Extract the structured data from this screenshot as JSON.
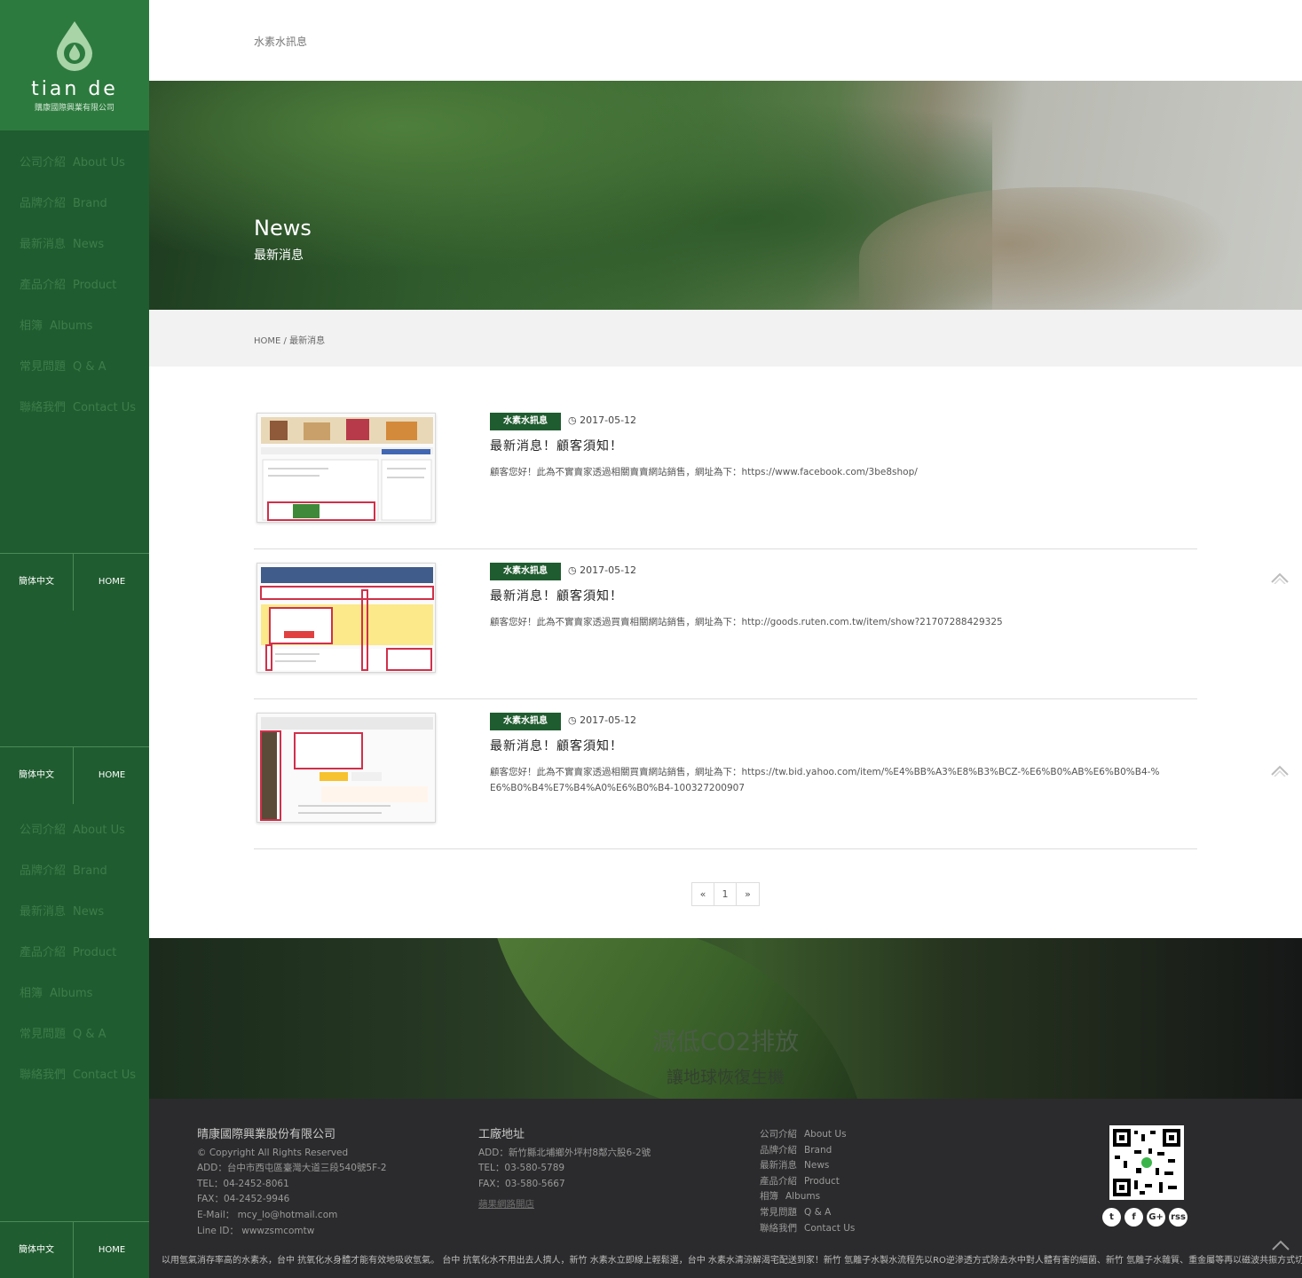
{
  "brand": {
    "name": "tian de",
    "subtitle": "購康國際興業有限公司"
  },
  "sidebar": {
    "items": [
      {
        "zh": "公司介紹",
        "en": "About Us"
      },
      {
        "zh": "品牌介紹",
        "en": "Brand"
      },
      {
        "zh": "最新消息",
        "en": "News"
      },
      {
        "zh": "產品介紹",
        "en": "Product"
      },
      {
        "zh": "相簿",
        "en": "Albums"
      },
      {
        "zh": "常見問題",
        "en": "Q & A"
      },
      {
        "zh": "聯絡我們",
        "en": "Contact Us"
      }
    ],
    "lang": "簡体中文",
    "home": "HOME"
  },
  "topbar": {
    "category": "水素水訊息"
  },
  "hero": {
    "title": "News",
    "subtitle": "最新消息"
  },
  "breadcrumb": {
    "home": "HOME",
    "sep": " / ",
    "current": "最新消息"
  },
  "articles": [
    {
      "tag": "水素水訊息",
      "date": "2017-05-12",
      "title": "最新消息！顧客須知！",
      "body": "顧客您好！此為不實賣家透過相關賣賣網站銷售，網址為下：https://www.facebook.com/3be8shop/"
    },
    {
      "tag": "水素水訊息",
      "date": "2017-05-12",
      "title": "最新消息！顧客須知！",
      "body": "顧客您好！此為不實賣家透過買賣相關網站銷售，網址為下：http://goods.ruten.com.tw/item/show?21707288429325"
    },
    {
      "tag": "水素水訊息",
      "date": "2017-05-12",
      "title": "最新消息！顧客須知！",
      "body": "顧客您好！此為不實賣家透過相關買賣網站銷售，網址為下：https://tw.bid.yahoo.com/item/%E4%BB%A3%E8%B3%BCZ-%E6%B0%AB%E6%B0%B4-%E6%B0%B4%E7%B4%A0%E6%B0%B4-100327200907"
    }
  ],
  "pager": {
    "prev": "«",
    "page": "1",
    "next": "»"
  },
  "band": {
    "line1": "減低CO2排放",
    "line2": "讓地球恢復生機"
  },
  "footer": {
    "company": {
      "name": "晴康國際興業股份有限公司",
      "copyright": "© Copyright All Rights Reserved",
      "add": "ADD：台中市西屯區臺灣大道三段540號5F-2",
      "tel": "TEL：04-2452-8061",
      "fax": "FAX：04-2452-9946",
      "email": "E-Mail： mcy_lo@hotmail.com",
      "line": "Line ID： wwwzsmcomtw"
    },
    "factory": {
      "title": "工廠地址",
      "add": "ADD：新竹縣北埔鄉外坪村8鄰六股6-2號",
      "tel": "TEL：03-580-5789",
      "fax": "FAX：03-580-5667",
      "link": "蘋果網路開店"
    },
    "social": [
      "t",
      "f",
      "G+",
      "rss"
    ],
    "marquee": "以用氫氣消存率高的水素水，台中 抗氧化水身體才能有效地吸收氫氣。 台中 抗氧化水不用出去人擠人，新竹 水素水立即線上輕鬆選，台中 水素水清涼解渴宅配送到家！新竹 氫離子水製水流程先以RO逆滲透方式除去水中對人體有害的細菌、新竹 氫離子水雜質、重金屬等再以磁波共振方式切"
  }
}
